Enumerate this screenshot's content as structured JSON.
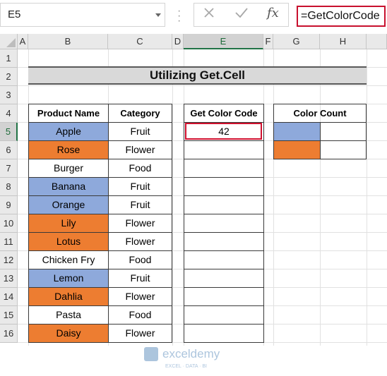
{
  "name_box": {
    "value": "E5"
  },
  "formula_bar": {
    "cancel_icon": "x-icon",
    "enter_icon": "check-icon",
    "function_icon": "fx-icon",
    "function_label": "fx",
    "formula": "=GetColorCode"
  },
  "columns": [
    "A",
    "B",
    "C",
    "D",
    "E",
    "F",
    "G",
    "H"
  ],
  "rows": [
    "1",
    "2",
    "3",
    "4",
    "5",
    "6",
    "7",
    "8",
    "9",
    "10",
    "11",
    "12",
    "13",
    "14",
    "15",
    "16"
  ],
  "sheet": {
    "title": "Utilizing Get.Cell",
    "product_table": {
      "headers": [
        "Product Name",
        "Category"
      ],
      "rows": [
        {
          "product": "Apple",
          "category": "Fruit",
          "fill": "blue"
        },
        {
          "product": "Rose",
          "category": "Flower",
          "fill": "orange"
        },
        {
          "product": "Burger",
          "category": "Food",
          "fill": "none"
        },
        {
          "product": "Banana",
          "category": "Fruit",
          "fill": "blue"
        },
        {
          "product": "Orange",
          "category": "Fruit",
          "fill": "blue"
        },
        {
          "product": "Lily",
          "category": "Flower",
          "fill": "orange"
        },
        {
          "product": "Lotus",
          "category": "Flower",
          "fill": "orange"
        },
        {
          "product": "Chicken Fry",
          "category": "Food",
          "fill": "none"
        },
        {
          "product": "Lemon",
          "category": "Fruit",
          "fill": "blue"
        },
        {
          "product": "Dahlia",
          "category": "Flower",
          "fill": "orange"
        },
        {
          "product": "Pasta",
          "category": "Food",
          "fill": "none"
        },
        {
          "product": "Daisy",
          "category": "Flower",
          "fill": "orange"
        }
      ]
    },
    "color_code_table": {
      "header": "Get Color Code",
      "values": [
        "42",
        "",
        "",
        "",
        "",
        "",
        "",
        "",
        "",
        "",
        "",
        ""
      ]
    },
    "color_count_table": {
      "header": "Color Count",
      "rows": [
        {
          "fill": "blue",
          "count": ""
        },
        {
          "fill": "orange",
          "count": ""
        }
      ]
    }
  },
  "colors": {
    "blue": "#8ea9db",
    "orange": "#ed7d31",
    "accent": "#217346",
    "highlight": "#d0102e"
  },
  "watermark": {
    "brand": "exceldemy",
    "tagline": "EXCEL · DATA · BI"
  }
}
